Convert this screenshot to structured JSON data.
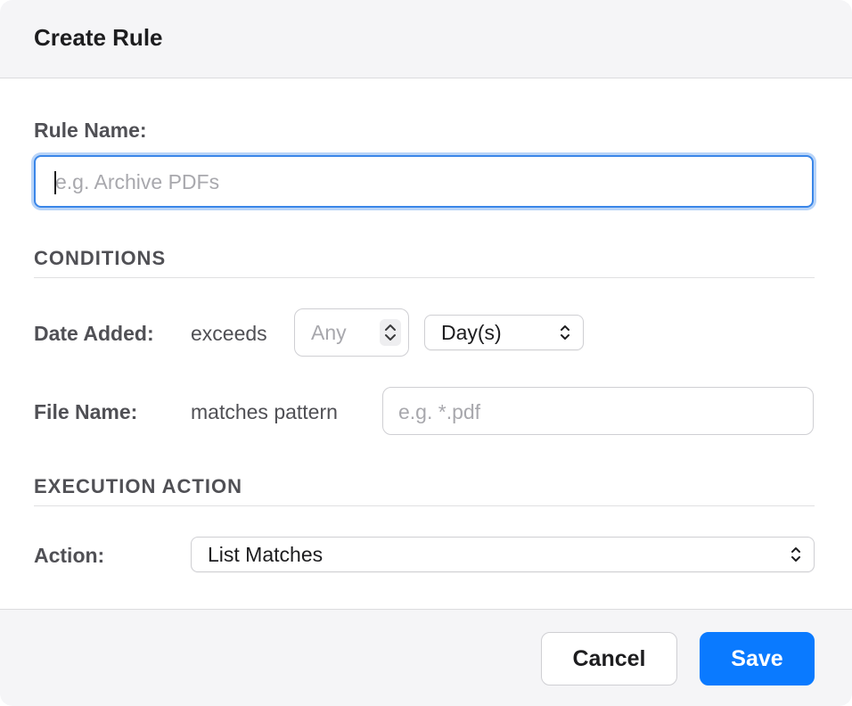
{
  "dialog": {
    "title": "Create Rule"
  },
  "rule_name": {
    "label": "Rule Name:",
    "value": "",
    "placeholder": "e.g. Archive PDFs"
  },
  "conditions": {
    "heading": "CONDITIONS",
    "date_added": {
      "label": "Date Added:",
      "operator": "exceeds",
      "amount_placeholder": "Any",
      "unit": "Day(s)"
    },
    "file_name": {
      "label": "File Name:",
      "operator": "matches pattern",
      "pattern_placeholder": "e.g. *.pdf"
    }
  },
  "execution": {
    "heading": "EXECUTION ACTION",
    "action_label": "Action:",
    "action_value": "List Matches"
  },
  "footer": {
    "cancel_label": "Cancel",
    "save_label": "Save"
  },
  "colors": {
    "accent": "#0a7aff",
    "focus_ring": "#3a86e8",
    "header_bg": "#f5f5f7"
  }
}
